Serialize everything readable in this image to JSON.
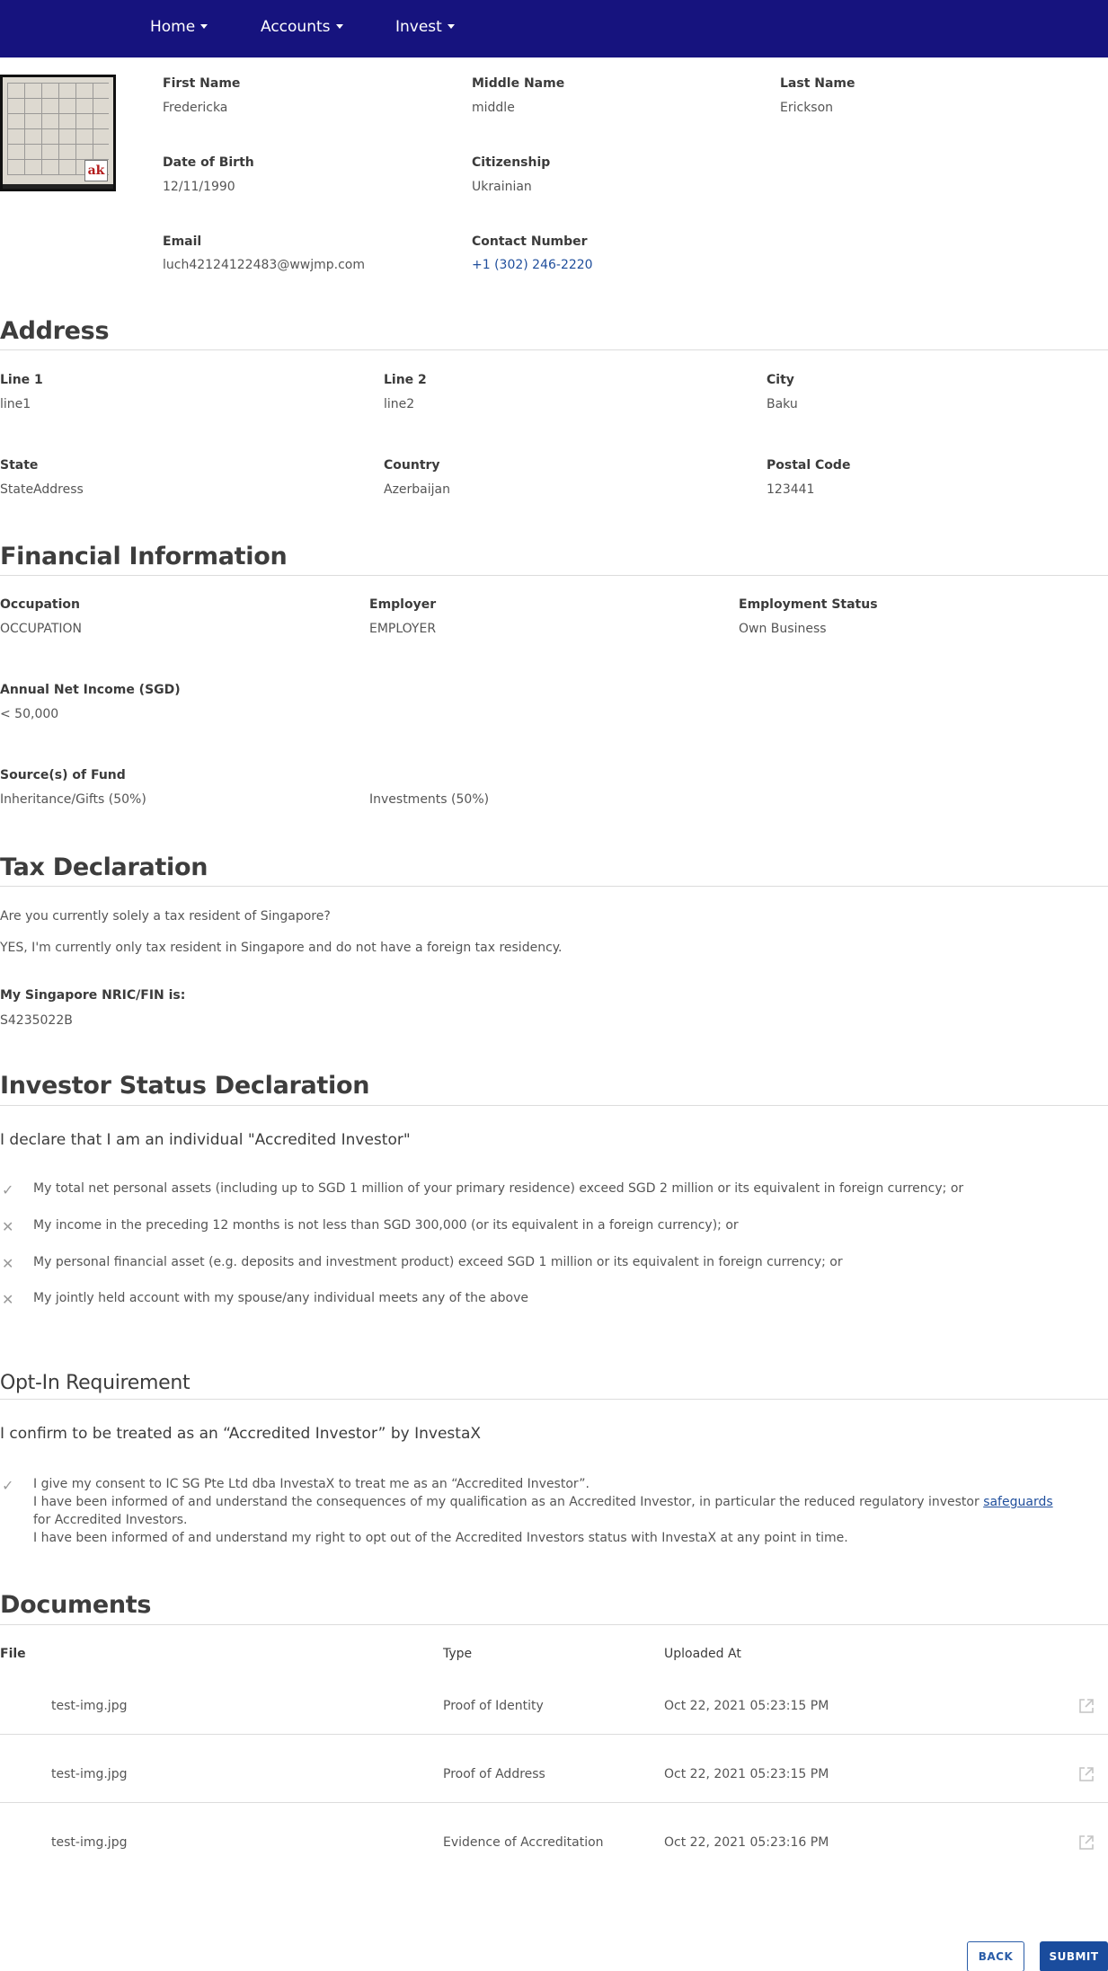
{
  "nav": {
    "items": [
      {
        "label": "Home"
      },
      {
        "label": "Accounts"
      },
      {
        "label": "Invest"
      }
    ]
  },
  "profile": {
    "first_name_label": "First Name",
    "first_name": "Fredericka",
    "middle_name_label": "Middle Name",
    "middle_name": "middle",
    "last_name_label": "Last Name",
    "last_name": "Erickson",
    "dob_label": "Date of Birth",
    "dob": "12/11/1990",
    "citizenship_label": "Citizenship",
    "citizenship": "Ukrainian",
    "email_label": "Email",
    "email": "luch42124122483@wwjmp.com",
    "contact_label": "Contact Number",
    "contact": "+1 (302) 246-2220"
  },
  "address": {
    "title": "Address",
    "line1_label": "Line 1",
    "line1": "line1",
    "line2_label": "Line 2",
    "line2": "line2",
    "city_label": "City",
    "city": "Baku",
    "state_label": "State",
    "state": "StateAddress",
    "country_label": "Country",
    "country": "Azerbaijan",
    "postal_label": "Postal Code",
    "postal": "123441"
  },
  "financial": {
    "title": "Financial Information",
    "occupation_label": "Occupation",
    "occupation": "OCCUPATION",
    "employer_label": "Employer",
    "employer": "EMPLOYER",
    "status_label": "Employment Status",
    "status": "Own Business",
    "income_label": "Annual Net Income (SGD)",
    "income": "< 50,000",
    "sources_label": "Source(s) of Fund",
    "sources": [
      "Inheritance/Gifts (50%)",
      "Investments (50%)"
    ]
  },
  "tax": {
    "title": "Tax Declaration",
    "question": "Are you currently solely a tax resident of Singapore?",
    "answer": "YES, I'm currently only tax resident in Singapore and do not have a foreign tax residency.",
    "nric_label": "My Singapore NRIC/FIN is:",
    "nric": "S4235022B"
  },
  "investor": {
    "title": "Investor Status Declaration",
    "subtitle": "I declare that I am an individual \"Accredited Investor\"",
    "items": [
      {
        "mark": "✓",
        "icon": "check-icon",
        "text": "My total net personal assets (including up to SGD 1 million of your primary residence) exceed SGD 2 million or its equivalent in foreign currency; or"
      },
      {
        "mark": "✕",
        "icon": "cross-icon",
        "text": "My income in the preceding 12 months is not less than SGD 300,000 (or its equivalent in a foreign currency); or"
      },
      {
        "mark": "✕",
        "icon": "cross-icon",
        "text": "My personal financial asset (e.g. deposits and investment product) exceed SGD 1 million or its equivalent in foreign currency; or"
      },
      {
        "mark": "✕",
        "icon": "cross-icon",
        "text": "My jointly held account with my spouse/any individual meets any of the above"
      }
    ]
  },
  "optin": {
    "title": "Opt-In Requirement",
    "subtitle": "I confirm to be treated as an “Accredited Investor” by InvestaX",
    "mark": "✓",
    "line1": "I give my consent to IC SG Pte Ltd dba InvestaX to treat me as an “Accredited Investor”.",
    "line2_before": "I have been informed of and understand the consequences of my qualification as an Accredited Investor, in particular the reduced regulatory investor ",
    "line2_link": "safeguards",
    "line2_after": " for Accredited Investors.",
    "line3": "I have been informed of and understand my right to opt out of the Accredited Investors status with InvestaX at any point in time."
  },
  "documents": {
    "title": "Documents",
    "headers": {
      "file": "File",
      "type": "Type",
      "uploaded": "Uploaded At"
    },
    "rows": [
      {
        "file": "test-img.jpg",
        "type": "Proof of Identity",
        "uploaded": "Oct 22, 2021 05:23:15 PM"
      },
      {
        "file": "test-img.jpg",
        "type": "Proof of Address",
        "uploaded": "Oct 22, 2021 05:23:15 PM"
      },
      {
        "file": "test-img.jpg",
        "type": "Evidence of Accreditation",
        "uploaded": "Oct 22, 2021 05:23:16 PM"
      }
    ]
  },
  "actions": {
    "back": "BACK",
    "submit": "SUBMIT"
  }
}
